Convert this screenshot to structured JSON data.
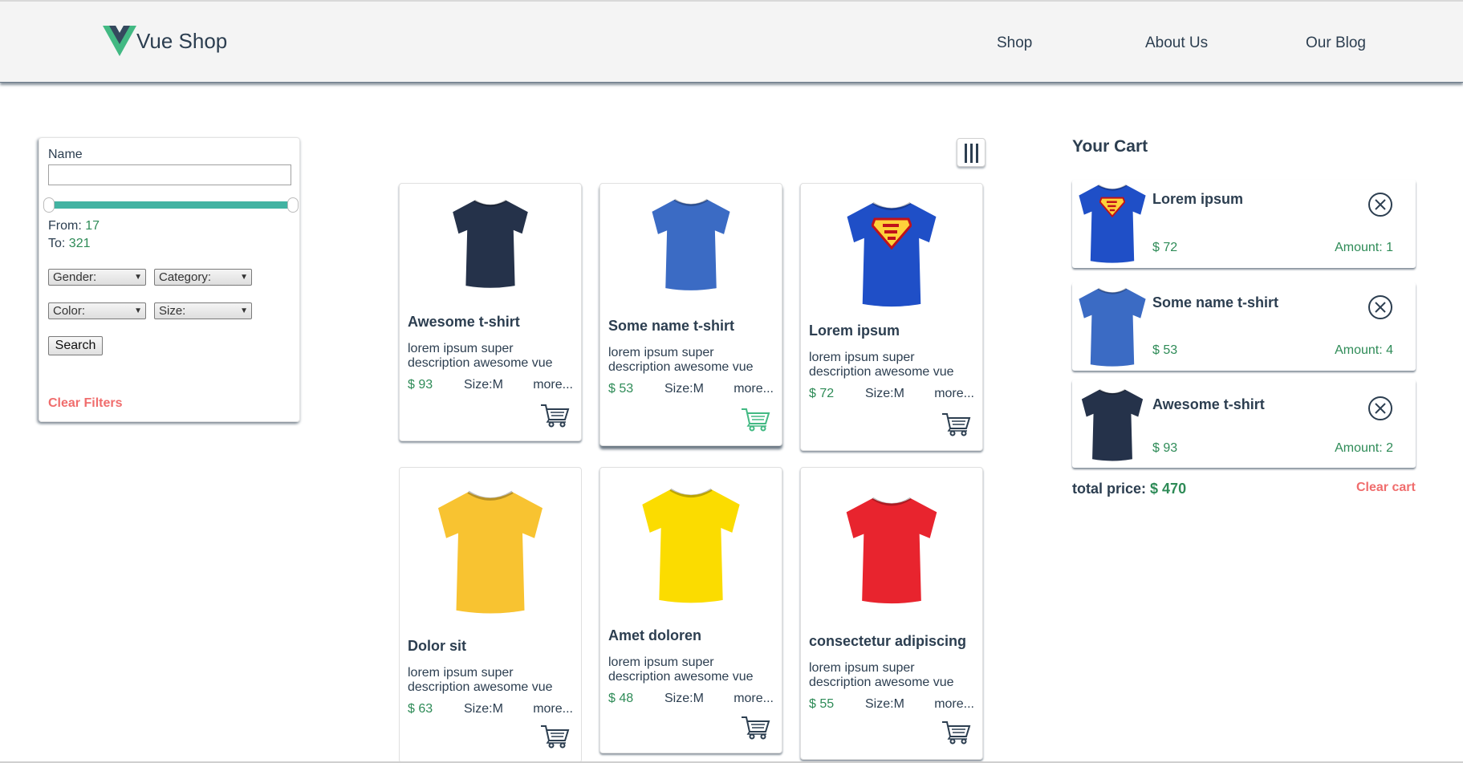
{
  "app": {
    "logo_text": "Vue Shop",
    "nav": [
      "Shop",
      "About Us",
      "Our Blog"
    ]
  },
  "filters": {
    "name_label": "Name",
    "name_value": "",
    "from_label": "From:",
    "from_value": "17",
    "to_label": "To:",
    "to_value": "321",
    "gender": "Gender:",
    "category": "Category:",
    "color": "Color:",
    "size": "Size:",
    "search_label": "Search",
    "clear_label": "Clear Filters"
  },
  "products": [
    {
      "title": "Awesome t-shirt",
      "desc": "lorem ipsum super description awesome vue",
      "price": "$ 93",
      "size": "Size:M",
      "more": "more...",
      "color": "#25324a"
    },
    {
      "title": "Some name t-shirt",
      "desc": "lorem ipsum super description awesome vue",
      "price": "$ 53",
      "size": "Size:M",
      "more": "more...",
      "color": "#3b6bc4"
    },
    {
      "title": "Lorem ipsum",
      "desc": "lorem ipsum super description awesome vue",
      "price": "$ 72",
      "size": "Size:M",
      "more": "more...",
      "color": "#1f4fc7"
    },
    {
      "title": "Dolor sit",
      "desc": "lorem ipsum super description awesome vue",
      "price": "$ 63",
      "size": "Size:M",
      "more": "more...",
      "color": "#f8c331"
    },
    {
      "title": "Amet doloren",
      "desc": "lorem ipsum super description awesome vue",
      "price": "$ 48",
      "size": "Size:M",
      "more": "more...",
      "color": "#fbdc00"
    },
    {
      "title": "consectetur adipiscing",
      "desc": "lorem ipsum super description awesome vue",
      "price": "$ 55",
      "size": "Size:M",
      "more": "more...",
      "color": "#e8242e"
    }
  ],
  "cart": {
    "title": "Your Cart",
    "items": [
      {
        "name": "Lorem ipsum",
        "price": "$ 72",
        "amount": "Amount: 1"
      },
      {
        "name": "Some name t-shirt",
        "price": "$ 53",
        "amount": "Amount: 4"
      },
      {
        "name": "Awesome t-shirt",
        "price": "$ 93",
        "amount": "Amount: 2"
      }
    ],
    "total_label": "total price:",
    "total_value": "$ 470",
    "clear_label": "Clear cart"
  },
  "colors": {
    "accent": "#2e8b57",
    "danger": "#f06d6d",
    "text": "#2c3e50",
    "range": "#42b3a2",
    "cart_active": "#42b983"
  },
  "icons": [
    "vue-logo-icon",
    "grid-toggle-icon",
    "cart-add-icon",
    "remove-circle-icon"
  ]
}
